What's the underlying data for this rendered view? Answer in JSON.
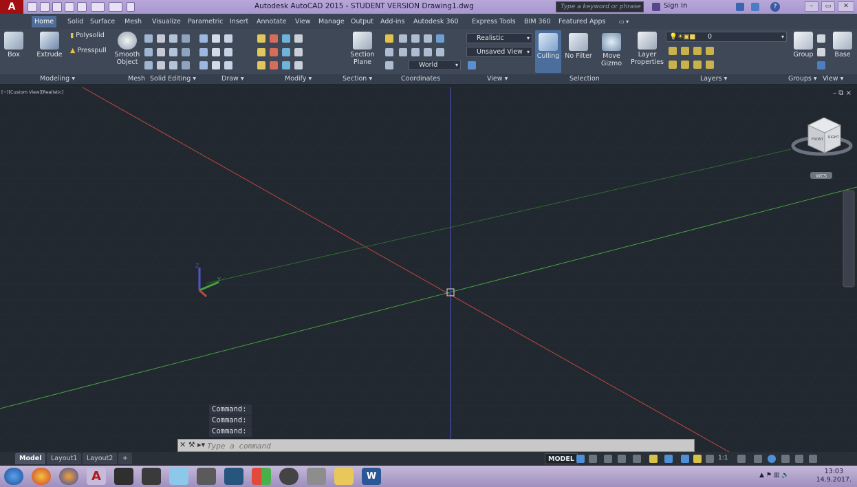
{
  "titlebar": {
    "title": "Autodesk AutoCAD 2015 - STUDENT VERSION   Drawing1.dwg",
    "search_placeholder": "Type a keyword or phrase",
    "sign_in": "Sign In"
  },
  "tabs": [
    "Home",
    "Solid",
    "Surface",
    "Mesh",
    "Visualize",
    "Parametric",
    "Insert",
    "Annotate",
    "View",
    "Manage",
    "Output",
    "Add-ins",
    "Autodesk 360",
    "Express Tools",
    "BIM 360",
    "Featured Apps"
  ],
  "ribbon": {
    "box": "Box",
    "extrude": "Extrude",
    "polysolid": "Polysolid",
    "presspull": "Presspull",
    "smooth_object_1": "Smooth",
    "smooth_object_2": "Object",
    "section_plane_1": "Section",
    "section_plane_2": "Plane",
    "visual_style": "Realistic",
    "view_name": "Unsaved View",
    "ucs": "World",
    "culling": "Culling",
    "no_filter": "No Filter",
    "move_gizmo_1": "Move",
    "move_gizmo_2": "Gizmo",
    "layer_props_1": "Layer",
    "layer_props_2": "Properties",
    "layer_current": "0",
    "group": "Group",
    "base": "Base"
  },
  "panels": [
    "Modeling ▾",
    "Mesh",
    "Solid Editing ▾",
    "Draw ▾",
    "Modify ▾",
    "Section ▾",
    "Coordinates",
    "View ▾",
    "Selection",
    "Layers ▾",
    "Groups ▾",
    "View ▾"
  ],
  "viewport": {
    "label": "[−][Custom View][Realistic]",
    "wcs": "WCS",
    "cube_front": "FRONT",
    "cube_right": "RIGHT",
    "controls": "– ⧉ ×"
  },
  "command": {
    "history": [
      "Command:",
      "Command:",
      "Command:"
    ],
    "placeholder": "Type a command"
  },
  "layout_tabs": [
    "Model",
    "Layout1",
    "Layout2"
  ],
  "status": {
    "model": "MODEL",
    "scale": "1:1"
  },
  "taskbar": {
    "time": "13:03",
    "date": "14.9.2017."
  },
  "colors": {
    "x_axis": "#c0473d",
    "y_axis": "#45a13e",
    "z_axis": "#4d56c8",
    "bg": "#222830"
  }
}
